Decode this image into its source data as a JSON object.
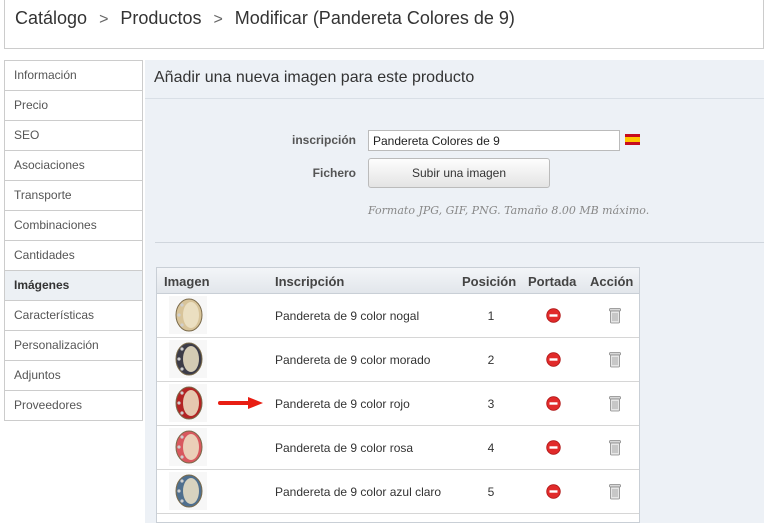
{
  "breadcrumb": {
    "catalog": "Catálogo",
    "products": "Productos",
    "current": "Modificar (Pandereta Colores de 9)",
    "separator": ">"
  },
  "sidebar": {
    "items": [
      {
        "label": "Información"
      },
      {
        "label": "Precio"
      },
      {
        "label": "SEO"
      },
      {
        "label": "Asociaciones"
      },
      {
        "label": "Transporte"
      },
      {
        "label": "Combinaciones"
      },
      {
        "label": "Cantidades"
      },
      {
        "label": "Imágenes",
        "active": true
      },
      {
        "label": "Características"
      },
      {
        "label": "Personalización"
      },
      {
        "label": "Adjuntos"
      },
      {
        "label": "Proveedores"
      }
    ]
  },
  "panel": {
    "title": "Añadir una nueva imagen para este producto",
    "caption_label": "inscripción",
    "caption_value": "Pandereta Colores de 9",
    "language_flag": "flag-es-icon",
    "file_label": "Fichero",
    "upload_button": "Subir una imagen",
    "hint": "Formato JPG, GIF, PNG. Tamaño 8.00 MB máximo."
  },
  "table": {
    "headers": {
      "image": "Imagen",
      "caption": "Inscripción",
      "position": "Posición",
      "cover": "Portada",
      "action": "Acción"
    },
    "rows": [
      {
        "caption": "Pandereta de 9 color nogal",
        "position": "1",
        "drum_color": "#d8c49a"
      },
      {
        "caption": "Pandereta de 9 color morado",
        "position": "2",
        "drum_color": "#3c3c48"
      },
      {
        "caption": "Pandereta de 9 color rojo",
        "position": "3",
        "drum_color": "#b32424"
      },
      {
        "caption": "Pandereta de 9 color rosa",
        "position": "4",
        "drum_color": "#d8585e"
      },
      {
        "caption": "Pandereta de 9 color azul claro",
        "position": "5",
        "drum_color": "#4f6f8e"
      }
    ]
  },
  "colors": {
    "content_bg": "#edf1f6",
    "cover_icon": "#e12a2a",
    "arrow": "#e81d12"
  }
}
